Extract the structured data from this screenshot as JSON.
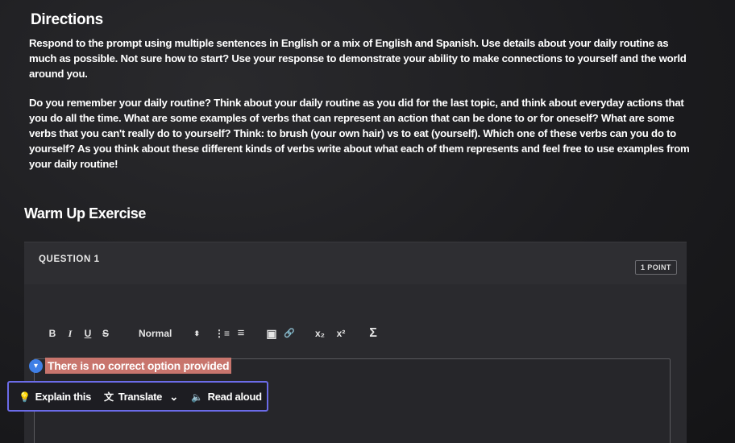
{
  "directions": {
    "title": "Directions",
    "paragraph_1": "Respond to the prompt using multiple sentences in English or a mix of English and Spanish. Use details about your daily routine as much as possible. Not sure how to start? Use your response to demonstrate your ability to make connections to yourself and the world around you.",
    "paragraph_2": "Do you remember your daily routine? Think about your daily routine as you did for the last topic, and think about everyday actions that you do all the time. What are some examples of verbs that can represent an action that can be done to or for oneself? What are some verbs that you can't really do to yourself? Think: to brush (your own hair) vs to eat (yourself). Which one of these verbs can you do to yourself? As you think about these different kinds of verbs write about what each of them represents and feel free to use examples from your daily routine!"
  },
  "section": {
    "title": "Warm Up Exercise"
  },
  "question": {
    "label": "QUESTION 1",
    "points": "1 POINT"
  },
  "toolbar": {
    "bold": "B",
    "italic": "I",
    "underline": "U",
    "strike": "S",
    "format_select": "Normal",
    "format_arrow": "⬍",
    "ordered_list": "⋮≡",
    "bullet_list": "≡",
    "image": "▣",
    "link": "🔗",
    "subscript": "x₂",
    "superscript": "x²",
    "formula": "Σ"
  },
  "feedback": {
    "text": "There is no correct option provided"
  },
  "reader": {
    "explain": "Explain this",
    "translate": "Translate",
    "translate_arrow": "⌄",
    "read_aloud": "Read aloud"
  },
  "colors": {
    "highlight": "#c8756d",
    "reader_border": "#6b6be8",
    "audio_dot": "#3f7fe6"
  }
}
